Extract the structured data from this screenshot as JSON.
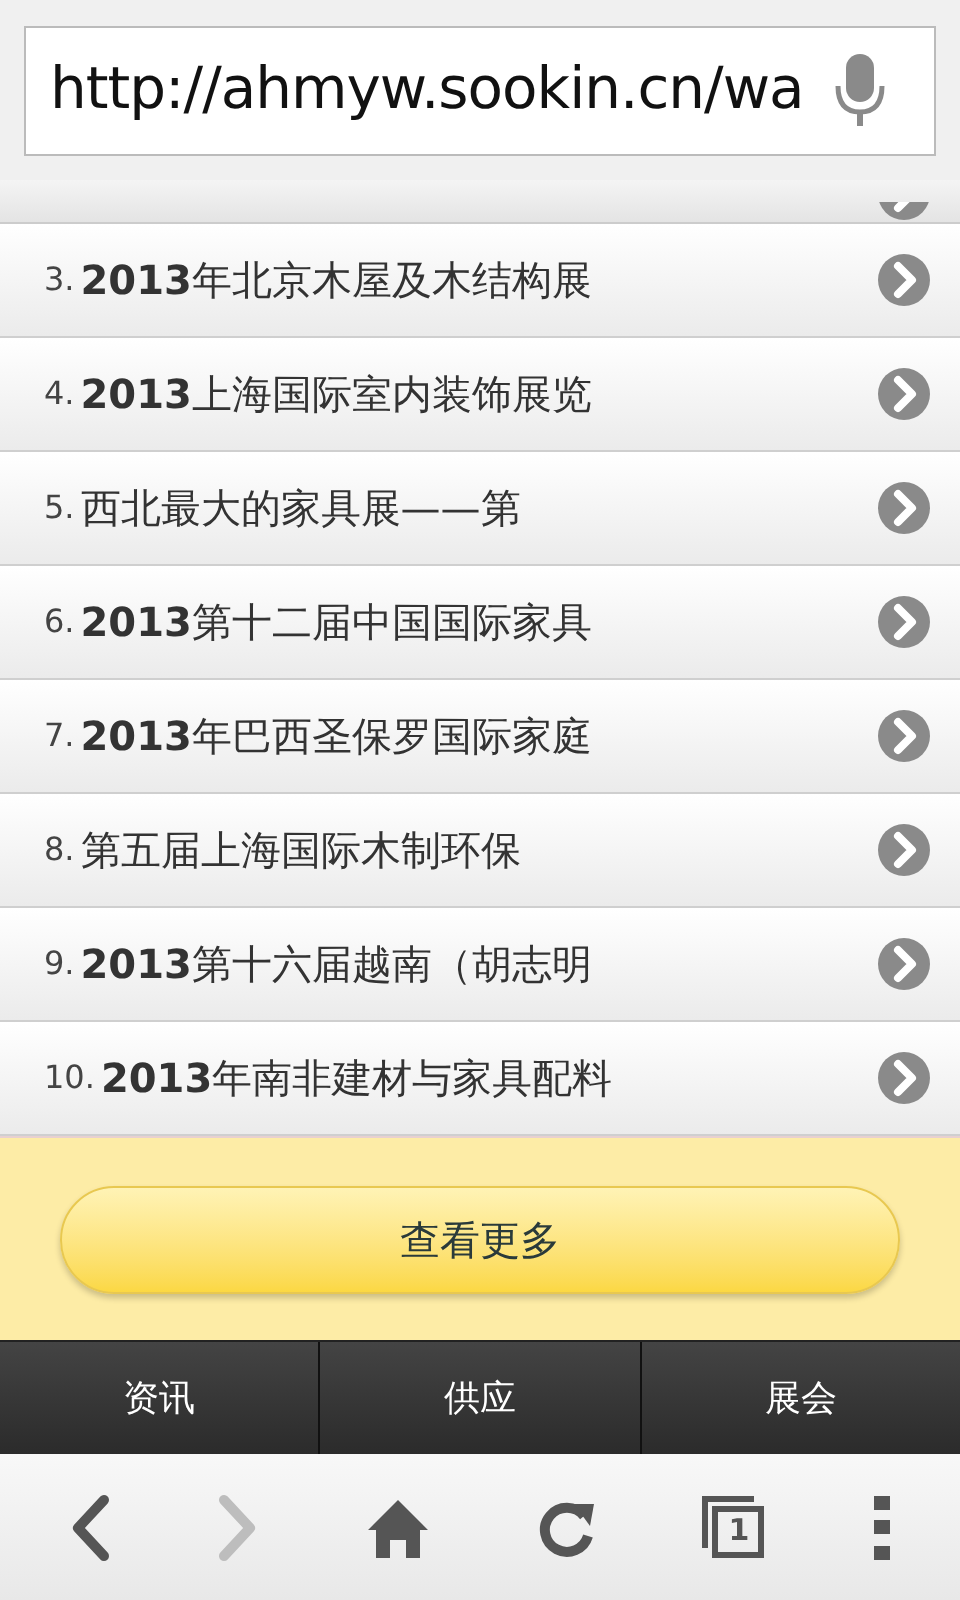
{
  "address_bar": {
    "url": "http://ahmyw.sookin.cn/wa"
  },
  "list": [
    {
      "index": "3.",
      "title": "**2013**年北京木屋及木结构展"
    },
    {
      "index": "4.",
      "title": "**2013**上海国际室内装饰展览"
    },
    {
      "index": "5.",
      "title": "西北最大的家具展——第"
    },
    {
      "index": "6.",
      "title": "**2013**第十二届中国国际家具"
    },
    {
      "index": "7.",
      "title": "**2013**年巴西圣保罗国际家庭"
    },
    {
      "index": "8.",
      "title": "第五届上海国际木制环保"
    },
    {
      "index": "9.",
      "title": "**2013**第十六届越南（胡志明"
    },
    {
      "index": "10.",
      "title": "**2013**年南非建材与家具配料"
    }
  ],
  "more_button": "查看更多",
  "nav_tabs": [
    "资讯",
    "供应",
    "展会"
  ],
  "toolbar": {
    "forward_disabled": true,
    "tab_count": "1"
  }
}
